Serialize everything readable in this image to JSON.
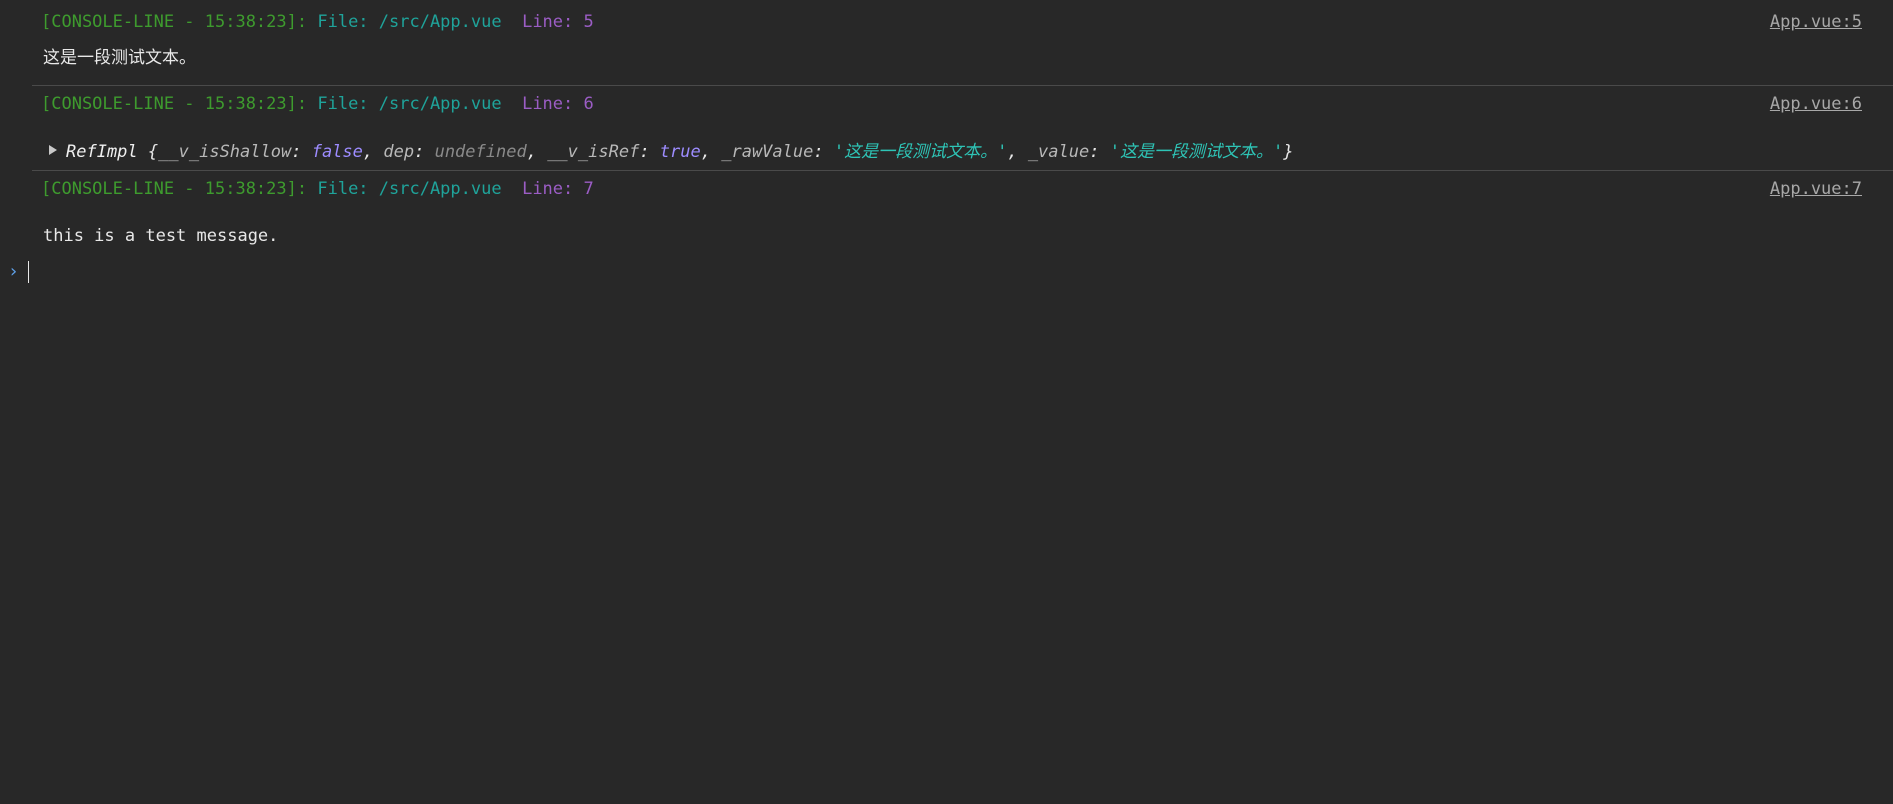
{
  "entries": [
    {
      "tag": "[CONSOLE-LINE - 15:38:23]:",
      "file": "File: /src/App.vue",
      "line": "Line: 5",
      "source_link": "App.vue:5",
      "message": "这是一段测试文本。"
    },
    {
      "tag": "[CONSOLE-LINE - 15:38:23]:",
      "file": "File: /src/App.vue",
      "line": "Line: 6",
      "source_link": "App.vue:6",
      "object": {
        "name": "RefImpl",
        "open_brace": "{",
        "k1": "__v_isShallow",
        "v1": "false",
        "k2": "dep",
        "v2": "undefined",
        "k3": "__v_isRef",
        "v3": "true",
        "k4": "_rawValue",
        "v4": "'这是一段测试文本。'",
        "k5": "_value",
        "v5": "'这是一段测试文本。'",
        "close_brace": "}",
        "colon": ": ",
        "comma": ", "
      }
    },
    {
      "tag": "[CONSOLE-LINE - 15:38:23]:",
      "file": "File: /src/App.vue",
      "line": "Line: 7",
      "source_link": "App.vue:7",
      "message": "this is a test message."
    }
  ],
  "prompt": {
    "symbol": "›"
  }
}
